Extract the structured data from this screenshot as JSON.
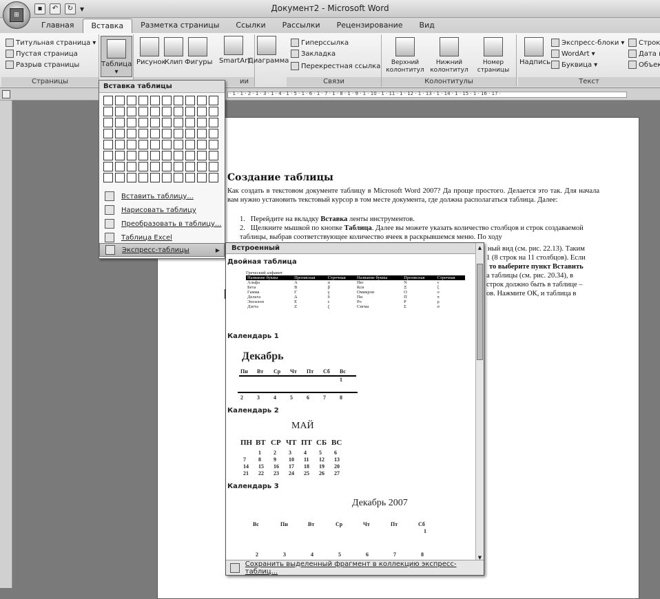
{
  "window": {
    "title": "Документ2 - Microsoft Word"
  },
  "tabs": [
    "Главная",
    "Вставка",
    "Разметка страницы",
    "Ссылки",
    "Рассылки",
    "Рецензирование",
    "Вид"
  ],
  "active_tab": "Вставка",
  "ribbon": {
    "pages": {
      "items": [
        "Титульная страница",
        "Пустая страница",
        "Разрыв страницы"
      ],
      "label": "Страницы"
    },
    "tables": {
      "button": "Таблица"
    },
    "illustrations": {
      "buttons": [
        "Рисунок",
        "Клип",
        "Фигуры",
        "SmartArt",
        "Диаграмма"
      ],
      "label_tail": "ии"
    },
    "links": {
      "items": [
        "Гиперссылка",
        "Закладка",
        "Перекрестная ссылка"
      ],
      "label": "Связи"
    },
    "headers": {
      "buttons": [
        "Верхний колонтитул",
        "Нижний колонтитул",
        "Номер страницы"
      ],
      "label": "Колонтитулы"
    },
    "text": {
      "button": "Надпись",
      "items": [
        "Экспресс-блоки",
        "WordArt",
        "Буквица"
      ],
      "right_items": [
        "Строка",
        "Дата и",
        "Объект"
      ],
      "label": "Текст"
    }
  },
  "table_menu": {
    "title": "Вставка таблицы",
    "items": [
      "Вставить таблицу...",
      "Нарисовать таблицу",
      "Преобразовать в таблицу...",
      "Таблица Excel",
      "Экспресс-таблицы"
    ]
  },
  "gallery": {
    "header": "Встроенный",
    "sections": [
      "Двойная таблица",
      "Календарь 1",
      "Календарь 2",
      "Календарь 3"
    ],
    "footer": "Сохранить выделенный фрагмент в коллекцию экспресс-таблиц...",
    "greek": {
      "caption": "Греческий алфавит",
      "headers": [
        "Название буквы",
        "Прописная",
        "Строчная",
        "Название буквы",
        "Прописная",
        "Строчная"
      ],
      "rows": [
        [
          "Альфа",
          "Α",
          "α",
          "Ню",
          "Ν",
          "ν"
        ],
        [
          "Бета",
          "Β",
          "β",
          "Кси",
          "Ξ",
          "ξ"
        ],
        [
          "Гамма",
          "Γ",
          "γ",
          "Омикрон",
          "Ο",
          "ο"
        ],
        [
          "Дельта",
          "Δ",
          "δ",
          "Пи",
          "Π",
          "π"
        ],
        [
          "Эпсилон",
          "Ε",
          "ε",
          "Ро",
          "Ρ",
          "ρ"
        ],
        [
          "Дзета",
          "Ζ",
          "ζ",
          "Сигма",
          "Σ",
          "σ"
        ]
      ]
    },
    "cal1": {
      "month": "Декабрь",
      "days": [
        "Пн",
        "Вт",
        "Ср",
        "Чт",
        "Пт",
        "Сб",
        "Вс"
      ],
      "row1_last": "1",
      "row2": [
        "2",
        "3",
        "4",
        "5",
        "6",
        "7",
        "8"
      ]
    },
    "cal2": {
      "month": "МАЙ",
      "days": [
        "ПН",
        "ВТ",
        "СР",
        "ЧТ",
        "ПТ",
        "СБ",
        "ВС"
      ],
      "rows": [
        [
          "",
          "1",
          "2",
          "3",
          "4",
          "5",
          "6"
        ],
        [
          "7",
          "8",
          "9",
          "10",
          "11",
          "12",
          "13"
        ],
        [
          "14",
          "15",
          "16",
          "17",
          "18",
          "19",
          "20"
        ],
        [
          "21",
          "22",
          "23",
          "24",
          "25",
          "26",
          "27"
        ]
      ]
    },
    "cal3": {
      "title": "Декабрь 2007",
      "days": [
        "Вс",
        "Пн",
        "Вт",
        "Ср",
        "Чт",
        "Пт",
        "Сб"
      ],
      "row1_last": "1",
      "row2": [
        "2",
        "3",
        "4",
        "5",
        "6",
        "7",
        "8"
      ]
    }
  },
  "document": {
    "heading": "Создание таблицы",
    "paragraph": "Как создать в текстовом документе таблицу в Microsoft Word 2007? Да проще простого. Делается это так. Для начала вам нужно установить текстовый курсор в том месте документа, где должна располагаться таблица. Далее:",
    "li1_num": "1.",
    "li1_a": "Перейдите на вкладку ",
    "li1_b": "Вставка",
    "li1_c": " ленты инструментов.",
    "li2_num": "2.",
    "li2_a": "Щелкните мышкой по кнопке ",
    "li2_b": "Таблица",
    "li2_c": ". Далее вы можете указать количество столбцов и строк создаваемой таблицы, выбрав соответствующее количество ячеек в раскрывшемся меню. По ходу",
    "frag1": "ный вид (см. рис. 22.13). Таким",
    "frag2": "1 (8 строк на 11 столбцов). Если",
    "frag3": "то выберите пункт Вставить",
    "frag4": "а таблицы (см. рис. 20.34), в",
    "frag5": "строк должно быть в таблице –",
    "frag6": "ов. Нажмите ОК, и таблица в"
  },
  "ruler_numbers": "· 1 · 1 · 2 · 1 · 3 · 1 · 4 · 1 · 5 · 1 · 6 · 1 · 7 · 1 · 8 · 1 · 9 · 1 · 10 · 1 · 11 · 1 · 12 · 1 · 13 · 1 · 14 · 1 · 15 · 1 · 16 · 17 ·"
}
